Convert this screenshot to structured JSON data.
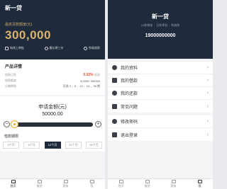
{
  "left": {
    "app_title": "新一贷",
    "quota_caption": "最高贷款额度(元)",
    "quota_amount": "300,000",
    "features": [
      {
        "label": "纯线上审批",
        "icon": "document-icon"
      },
      {
        "label": "最长期三年",
        "icon": "clock-icon"
      },
      {
        "label": "秒级放款",
        "icon": "lightning-icon"
      }
    ],
    "details": {
      "title": "产品详情",
      "rows": [
        {
          "label": "借款日息",
          "value": "0.02%",
          "suffix": "低息"
        },
        {
          "label": "借款额度",
          "value": "5,0000~300000"
        },
        {
          "label": "分期期限",
          "value": "可选 3 、6 、12 、24 、36 期"
        }
      ]
    },
    "amount": {
      "label": "申请金额(元)",
      "value": "50000.00",
      "minus": "−",
      "plus": "+",
      "slider_fraction": 0.0
    },
    "period_caption": "借款期限",
    "periods": [
      "3个月",
      "6个月",
      "12个月",
      "24个月",
      "36个月"
    ],
    "active_period": "12个月"
  },
  "tabs": [
    "首页",
    "借贷",
    "客服",
    "我"
  ],
  "right": {
    "title": "新一贷",
    "subtitle": [
      "10秒审核",
      "日利率低",
      "秒放款"
    ],
    "phone": "19000000000",
    "menu_group1": [
      {
        "label": "我的资料",
        "icon": "profile-icon"
      },
      {
        "label": "我的借款",
        "icon": "loan-icon"
      },
      {
        "label": "我的还款",
        "icon": "repayment-icon"
      },
      {
        "label": "常见问题",
        "icon": "faq-icon"
      }
    ],
    "menu_group2": [
      {
        "label": "修改密码",
        "icon": "lock-icon"
      },
      {
        "label": "退出登录",
        "icon": "logout-icon"
      }
    ]
  },
  "colors": {
    "header_bg": "#1f2a3c",
    "quota_gold": "#d9b36e",
    "rate_red": "#e3502b",
    "slider_knob": "#f0a623"
  }
}
